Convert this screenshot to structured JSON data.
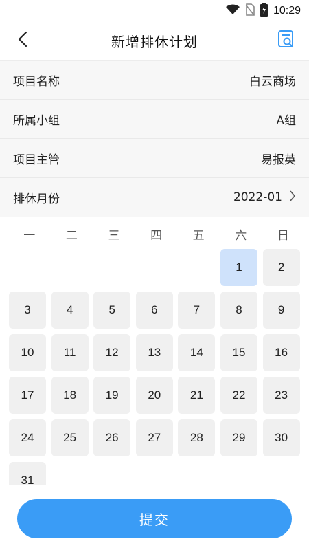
{
  "status_bar": {
    "time": "10:29",
    "icons": [
      "wifi-icon",
      "no-sim-icon",
      "battery-charging-icon"
    ]
  },
  "header": {
    "title": "新增排休计划",
    "back_icon": "back-icon",
    "search_icon": "search-document-icon"
  },
  "form": {
    "project_name": {
      "label": "项目名称",
      "value": "白云商场"
    },
    "group": {
      "label": "所属小组",
      "value": "A组"
    },
    "manager": {
      "label": "项目主管",
      "value": "易报英"
    },
    "month": {
      "label": "排休月份",
      "value": "2022-01"
    }
  },
  "calendar": {
    "weekdays": [
      "一",
      "二",
      "三",
      "四",
      "五",
      "六",
      "日"
    ],
    "first_weekday_index": 5,
    "days": [
      "1",
      "2",
      "3",
      "4",
      "5",
      "6",
      "7",
      "8",
      "9",
      "10",
      "11",
      "12",
      "13",
      "14",
      "15",
      "16",
      "17",
      "18",
      "19",
      "20",
      "21",
      "22",
      "23",
      "24",
      "25",
      "26",
      "27",
      "28",
      "29",
      "30",
      "31"
    ],
    "selected": [
      "1"
    ],
    "colors": {
      "selected_bg": "#cfe2fb",
      "day_bg": "#f0f0f0"
    }
  },
  "footer": {
    "submit_label": "提交",
    "accent": "#3a9cf6"
  }
}
